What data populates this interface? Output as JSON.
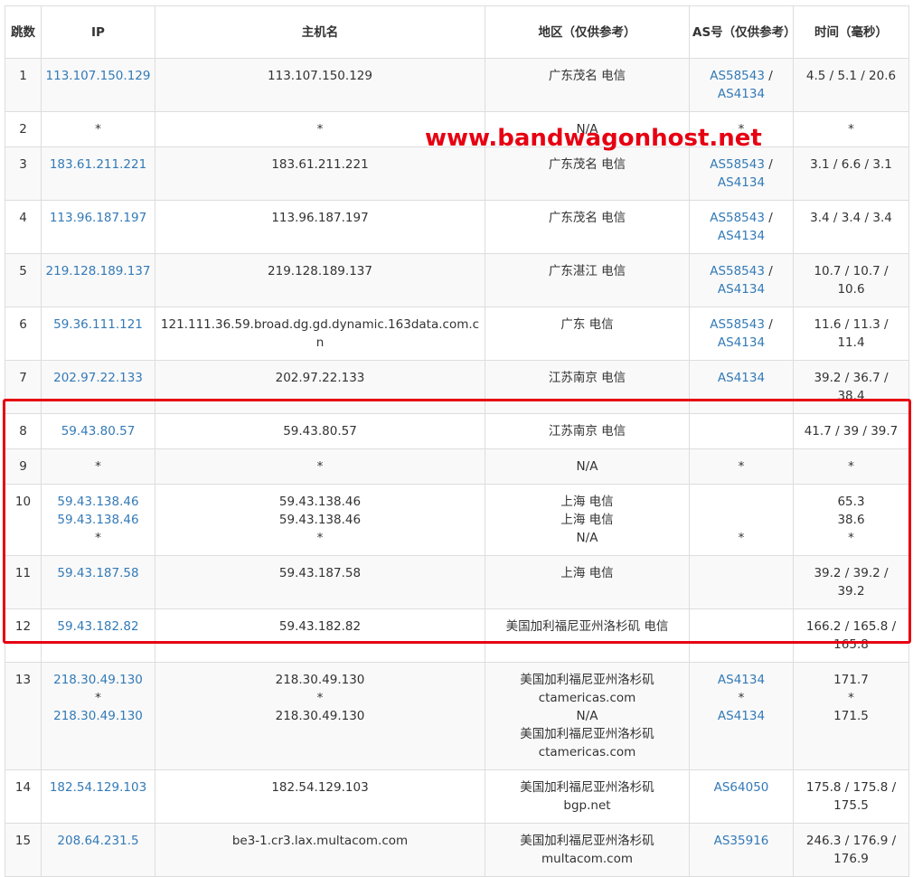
{
  "headers": {
    "hop": "跳数",
    "ip": "IP",
    "host": "主机名",
    "region": "地区（仅供参考）",
    "as": "AS号（仅供参考）",
    "time": "时间（毫秒）"
  },
  "rows": [
    {
      "hop": "1",
      "ip": [
        "113.107.150.129"
      ],
      "host": [
        "113.107.150.129"
      ],
      "region": [
        "广东茂名 电信"
      ],
      "as": [
        [
          "AS58543",
          " / "
        ],
        [
          "AS4134",
          ""
        ]
      ],
      "time": [
        "4.5 / 5.1 / 20.6"
      ]
    },
    {
      "hop": "2",
      "ip": [
        "*"
      ],
      "host": [
        "*"
      ],
      "region": [
        "N/A"
      ],
      "as": [
        [
          "*",
          ""
        ]
      ],
      "time": [
        "*"
      ]
    },
    {
      "hop": "3",
      "ip": [
        "183.61.211.221"
      ],
      "host": [
        "183.61.211.221"
      ],
      "region": [
        "广东茂名 电信"
      ],
      "as": [
        [
          "AS58543",
          " / "
        ],
        [
          "AS4134",
          ""
        ]
      ],
      "time": [
        "3.1 / 6.6 / 3.1"
      ]
    },
    {
      "hop": "4",
      "ip": [
        "113.96.187.197"
      ],
      "host": [
        "113.96.187.197"
      ],
      "region": [
        "广东茂名 电信"
      ],
      "as": [
        [
          "AS58543",
          " / "
        ],
        [
          "AS4134",
          ""
        ]
      ],
      "time": [
        "3.4 / 3.4 / 3.4"
      ]
    },
    {
      "hop": "5",
      "ip": [
        "219.128.189.137"
      ],
      "host": [
        "219.128.189.137"
      ],
      "region": [
        "广东湛江 电信"
      ],
      "as": [
        [
          "AS58543",
          " / "
        ],
        [
          "AS4134",
          ""
        ]
      ],
      "time": [
        "10.7 / 10.7 /",
        "10.6"
      ]
    },
    {
      "hop": "6",
      "ip": [
        "59.36.111.121"
      ],
      "host": [
        "121.111.36.59.broad.dg.gd.dynamic.163data.com.cn"
      ],
      "region": [
        "广东 电信"
      ],
      "as": [
        [
          "AS58543",
          " / "
        ],
        [
          "AS4134",
          ""
        ]
      ],
      "time": [
        "11.6 / 11.3 /",
        "11.4"
      ]
    },
    {
      "hop": "7",
      "ip": [
        "202.97.22.133"
      ],
      "host": [
        "202.97.22.133"
      ],
      "region": [
        "江苏南京 电信"
      ],
      "as": [
        [
          "AS4134",
          ""
        ]
      ],
      "time": [
        "39.2 / 36.7 /",
        "38.4"
      ]
    },
    {
      "hop": "8",
      "ip": [
        "59.43.80.57"
      ],
      "host": [
        "59.43.80.57"
      ],
      "region": [
        "江苏南京 电信"
      ],
      "as": [],
      "time": [
        "41.7 / 39 / 39.7"
      ]
    },
    {
      "hop": "9",
      "ip": [
        "*"
      ],
      "host": [
        "*"
      ],
      "region": [
        "N/A"
      ],
      "as": [
        [
          "*",
          ""
        ]
      ],
      "time": [
        "*"
      ]
    },
    {
      "hop": "10",
      "ip": [
        "59.43.138.46",
        "59.43.138.46",
        "*"
      ],
      "host": [
        "59.43.138.46",
        "59.43.138.46",
        "*"
      ],
      "region": [
        "上海 电信",
        "上海 电信",
        "N/A"
      ],
      "as": [
        [
          "",
          ""
        ],
        [
          "",
          ""
        ],
        [
          "*",
          ""
        ]
      ],
      "time": [
        "65.3",
        "38.6",
        "*"
      ]
    },
    {
      "hop": "11",
      "ip": [
        "59.43.187.58"
      ],
      "host": [
        "59.43.187.58"
      ],
      "region": [
        "上海 电信"
      ],
      "as": [],
      "time": [
        "39.2 / 39.2 /",
        "39.2"
      ]
    },
    {
      "hop": "12",
      "ip": [
        "59.43.182.82"
      ],
      "host": [
        "59.43.182.82"
      ],
      "region": [
        "美国加利福尼亚州洛杉矶 电信"
      ],
      "as": [],
      "time": [
        "166.2 / 165.8 /",
        "165.8"
      ]
    },
    {
      "hop": "13",
      "ip": [
        "218.30.49.130",
        "*",
        "218.30.49.130"
      ],
      "host": [
        "218.30.49.130",
        "*",
        "218.30.49.130"
      ],
      "region": [
        "美国加利福尼亚州洛杉矶",
        "ctamericas.com",
        "N/A",
        "美国加利福尼亚州洛杉矶",
        "ctamericas.com"
      ],
      "as": [
        [
          "AS4134",
          ""
        ],
        [
          "*",
          ""
        ],
        [
          "AS4134",
          ""
        ]
      ],
      "time": [
        "171.7",
        "*",
        "171.5"
      ]
    },
    {
      "hop": "14",
      "ip": [
        "182.54.129.103"
      ],
      "host": [
        "182.54.129.103"
      ],
      "region": [
        "美国加利福尼亚州洛杉矶",
        "bgp.net"
      ],
      "as": [
        [
          "AS64050",
          ""
        ]
      ],
      "time": [
        "175.8 / 175.8 /",
        "175.5"
      ]
    },
    {
      "hop": "15",
      "ip": [
        "208.64.231.5"
      ],
      "host": [
        "be3-1.cr3.lax.multacom.com"
      ],
      "region": [
        "美国加利福尼亚州洛杉矶",
        "multacom.com"
      ],
      "as": [
        [
          "AS35916",
          ""
        ]
      ],
      "time": [
        "246.3 / 176.9 /",
        "176.9"
      ]
    }
  ],
  "watermark": "www.bandwagonhost.net",
  "colors": {
    "link": "#337ab7",
    "highlight": "#e60012",
    "stripe": "#f9f9f9",
    "border": "#dddddd"
  }
}
